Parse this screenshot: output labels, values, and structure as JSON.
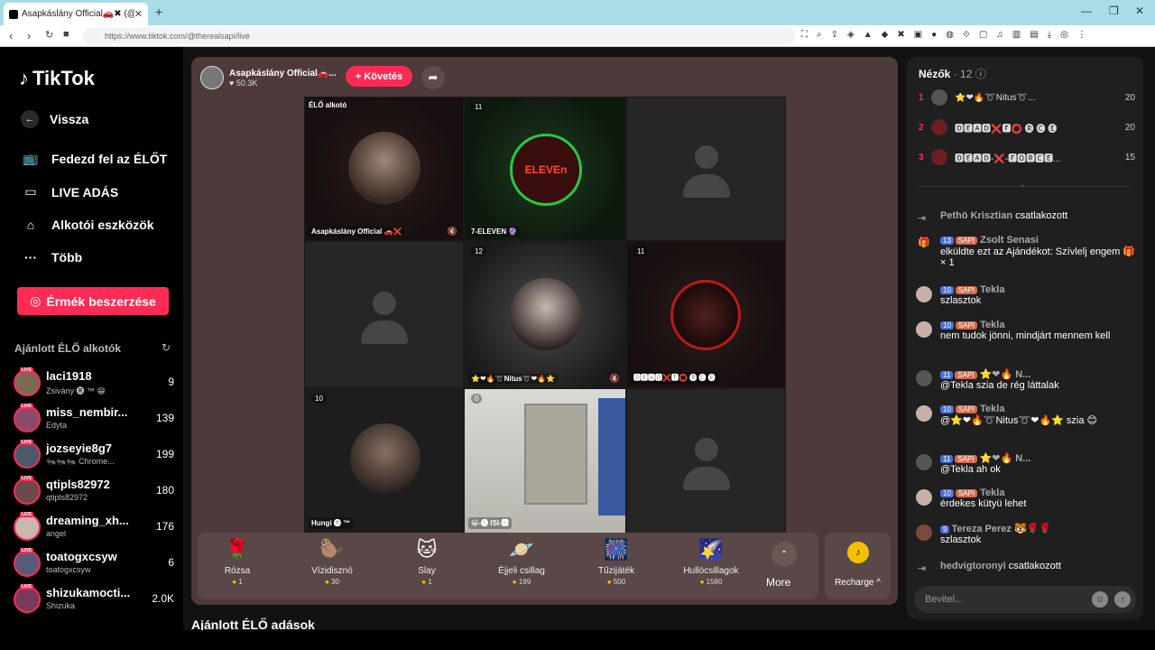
{
  "browser": {
    "tab_title": "Asapkáslány Official🚗✖ (@",
    "new_tab": "+",
    "url": "https://www.tiktok.com/@therealsapi/live",
    "window_controls": [
      "—",
      "❐",
      "✕"
    ]
  },
  "sidebar": {
    "brand": "TikTok",
    "back": "Vissza",
    "items": [
      {
        "label": "Fedezd fel az ÉLŐT",
        "icon": "tv-icon"
      },
      {
        "label": "LIVE ADÁS",
        "icon": "camera-icon"
      },
      {
        "label": "Alkotói eszközök",
        "icon": "house-icon"
      },
      {
        "label": "Több",
        "icon": "more-icon"
      }
    ],
    "coins_button": "Érmék beszerzése",
    "recommended_title": "Ajánlott ÉLŐ alkotók",
    "live_badge": "LIVE",
    "recommended": [
      {
        "name": "laci1918",
        "sub": "Zsivány 🅡 ™ 😁",
        "count": "9"
      },
      {
        "name": "miss_nembir...",
        "sub": "Edyta",
        "count": "139"
      },
      {
        "name": "jozseyie8g7",
        "sub": "🐜🐜🐜 Chrome...",
        "count": "199"
      },
      {
        "name": "qtipls82972",
        "sub": "qtipls82972",
        "count": "180"
      },
      {
        "name": "dreaming_xh...",
        "sub": "angel",
        "count": "176"
      },
      {
        "name": "toatogxcsyw",
        "sub": "toatogxcsyw",
        "count": "6"
      },
      {
        "name": "shizukamocti...",
        "sub": "Shizuka",
        "count": "2.0K"
      }
    ]
  },
  "stream": {
    "host_name": "Asapkáslány Official🚗...",
    "host_likes": "♥ 50.3K",
    "follow": "+ Követés",
    "cells": [
      {
        "label": "ÉLŐ alkotó",
        "name": "Asapkáslány Official 🚗❌"
      },
      {
        "badge": "11",
        "name": "7-ELEVEN 🔮"
      },
      {},
      {},
      {
        "badge": "12",
        "name": "⭐❤🔥➰Nitus➰❤🔥⭐"
      },
      {
        "badge": "11",
        "name": "🅳🅴🅰🅳❌🅵⭕ 🅡 🅒 🅔"
      },
      {
        "badge": "10",
        "name": "Hungi 🅡 ™"
      },
      {
        "badge": "0",
        "name": "😀-🅢 ISI-🆇"
      },
      {}
    ],
    "seven_eleven_text": "ELEVEn"
  },
  "gifts": [
    {
      "name": "Rózsa",
      "price": "1",
      "icon": "🌹"
    },
    {
      "name": "Vízidisznó",
      "price": "30",
      "icon": "🦫"
    },
    {
      "name": "Slay",
      "price": "1",
      "icon": "🐱"
    },
    {
      "name": "Éjjeli csillag",
      "price": "199",
      "icon": "🪐"
    },
    {
      "name": "Tűzijáték",
      "price": "500",
      "icon": "🎆"
    },
    {
      "name": "Hullócsillagok",
      "price": "1580",
      "icon": "🌠"
    }
  ],
  "more_label": "More",
  "recharge_label": "Recharge ^",
  "recommended_lives": "Ajánlott ÉLŐ adások",
  "panel": {
    "viewers_title": "Nézők",
    "viewers_count": "· 12",
    "viewers": [
      {
        "rank": "1",
        "name": "⭐❤🔥➰Nitus➰...",
        "score": "20"
      },
      {
        "rank": "2",
        "name": "🅳🅴🅰🅳❌🅵⭕ 🅡 🅒 🅔",
        "score": "20"
      },
      {
        "rank": "3",
        "name": "🅳🅴🅰🅳-❌-🅵🅾🆁🅲🅴...",
        "score": "15"
      }
    ],
    "messages": [
      {
        "type": "join",
        "user": "Pethö Krisztian",
        "text": "csatlakozott"
      },
      {
        "type": "gift",
        "lvl": "13",
        "sub": "SAPI",
        "user": "Zsolt Senasi",
        "text": "elküldte ezt az Ajándékot: Szívlelj engem 🎁 × 1"
      },
      {
        "type": "chat",
        "lvl": "10",
        "sub": "SAPI",
        "user": "Tekla",
        "text": "szlasztok"
      },
      {
        "type": "chat",
        "lvl": "10",
        "sub": "SAPI",
        "user": "Tekla",
        "text": "nem tudok jönni, mindjárt mennem kell"
      },
      {
        "type": "chat",
        "lvl": "11",
        "sub": "SAPI",
        "user": "⭐❤🔥 N...",
        "text": "@Tekla szia de rég láttalak"
      },
      {
        "type": "chat",
        "lvl": "10",
        "sub": "SAPI",
        "user": "Tekla",
        "text": "@⭐❤🔥➰Nitus➰❤🔥⭐ szia 😊"
      },
      {
        "type": "chat",
        "lvl": "11",
        "sub": "SAPI",
        "user": "⭐❤🔥 N...",
        "text": "@Tekla ah ok"
      },
      {
        "type": "chat",
        "lvl": "10",
        "sub": "SAPI",
        "user": "Tekla",
        "text": "érdekes kütyü lehet"
      },
      {
        "type": "chat",
        "lvl": "9",
        "sub": "",
        "user": "Tereza Perez 🐯🌹🌹",
        "text": "szlasztok"
      },
      {
        "type": "join",
        "user": "hedvigtoronyi",
        "text": "csatlakozott"
      }
    ],
    "input_placeholder": "Bevitel..."
  }
}
